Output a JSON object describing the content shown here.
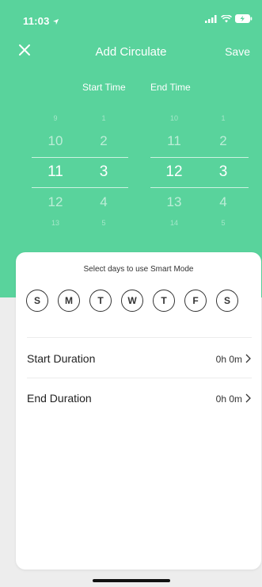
{
  "status": {
    "time": "11:03",
    "location_icon": "location-arrow-icon",
    "signal_icon": "cellular-signal-icon",
    "wifi_icon": "wifi-icon",
    "battery_icon": "battery-charging-icon"
  },
  "nav": {
    "title": "Add Circulate",
    "save_label": "Save",
    "close_icon": "close-icon"
  },
  "picker": {
    "start_label": "Start Time",
    "end_label": "End Time",
    "start_hours": [
      "9",
      "10",
      "11",
      "12",
      "13"
    ],
    "start_minutes": [
      "1",
      "2",
      "3",
      "4",
      "5"
    ],
    "end_hours": [
      "10",
      "11",
      "12",
      "13",
      "14"
    ],
    "end_minutes": [
      "1",
      "2",
      "3",
      "4",
      "5"
    ],
    "selected": {
      "start_hour": "11",
      "start_minute": "3",
      "end_hour": "12",
      "end_minute": "3"
    }
  },
  "sheet": {
    "days_title": "Select days to use Smart Mode",
    "days": [
      "S",
      "M",
      "T",
      "W",
      "T",
      "F",
      "S"
    ],
    "start_duration": {
      "label": "Start Duration",
      "value": "0h 0m"
    },
    "end_duration": {
      "label": "End Duration",
      "value": "0h 0m"
    }
  },
  "colors": {
    "accent_green": "#59d39c",
    "text_dark": "#222222"
  }
}
